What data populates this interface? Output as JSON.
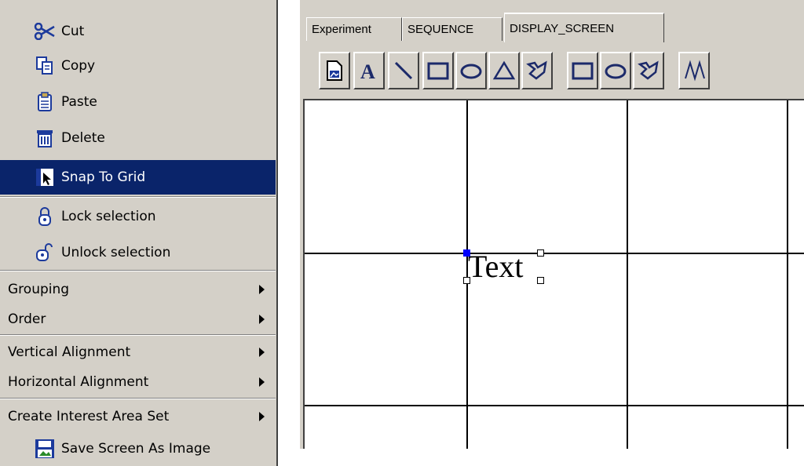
{
  "menu": {
    "items": [
      {
        "label": "Cut",
        "icon": "scissors-icon"
      },
      {
        "label": "Copy",
        "icon": "copy-icon"
      },
      {
        "label": "Paste",
        "icon": "paste-icon"
      },
      {
        "label": "Delete",
        "icon": "trash-icon"
      },
      {
        "label": "Snap To Grid",
        "icon": "snap-grid-icon",
        "highlighted": true
      },
      {
        "label": "Lock selection",
        "icon": "lock-icon"
      },
      {
        "label": "Unlock selection",
        "icon": "unlock-icon"
      },
      {
        "label": "Grouping",
        "submenu": true
      },
      {
        "label": "Order",
        "submenu": true
      },
      {
        "label": "Vertical Alignment",
        "submenu": true
      },
      {
        "label": "Horizontal Alignment",
        "submenu": true
      },
      {
        "label": "Create Interest Area Set",
        "submenu": true
      },
      {
        "label": "Save Screen As Image",
        "icon": "save-image-icon"
      }
    ]
  },
  "tabs": [
    {
      "label": "Experiment"
    },
    {
      "label": "SEQUENCE"
    },
    {
      "label": "DISPLAY_SCREEN",
      "active": true
    }
  ],
  "toolbar": {
    "tools": [
      "insert-resource-icon",
      "text-tool-icon",
      "line-tool-icon",
      "rectangle-tool-icon",
      "ellipse-tool-icon",
      "triangle-tool-icon",
      "freehand-polygon-tool-icon",
      "rect-interest-area-icon",
      "ellipse-interest-area-icon",
      "freehand-interest-area-icon",
      "auto-segment-icon"
    ]
  },
  "canvas": {
    "text_object": "Text"
  },
  "colors": {
    "menu_bg": "#d4d0c8",
    "highlight": "#0a246a",
    "selection_handle": "#0000ff"
  }
}
